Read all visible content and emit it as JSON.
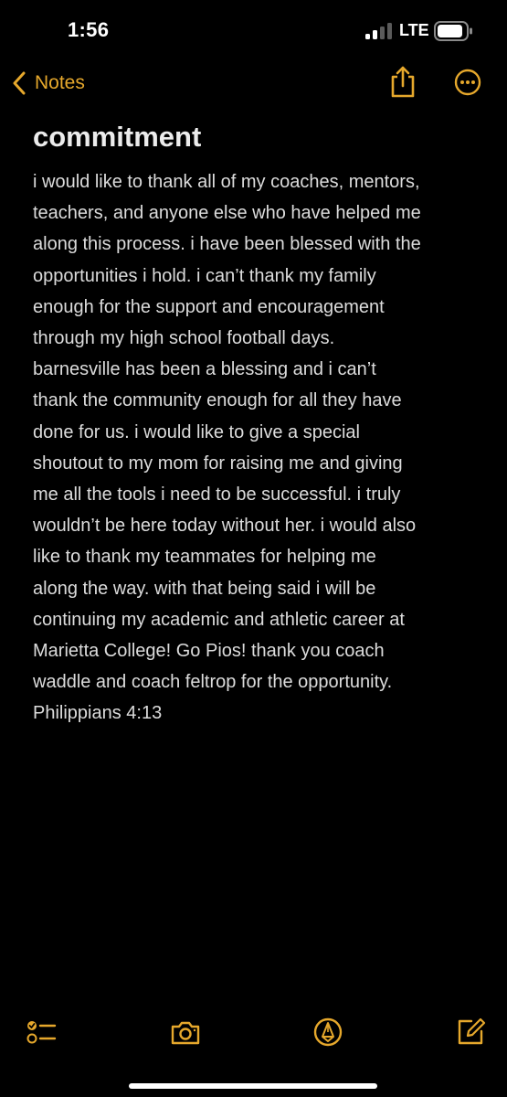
{
  "status_bar": {
    "time": "1:56",
    "carrier": "LTE",
    "icons": [
      "signal-bars-icon",
      "battery-icon"
    ]
  },
  "nav": {
    "back_label": "Notes",
    "icons": [
      "chevron-left-icon",
      "share-icon",
      "more-options-icon"
    ]
  },
  "note": {
    "title": "commitment",
    "lines": [
      "i would like to thank all of my coaches, mentors,",
      "teachers, and anyone else who have helped me",
      "along this process. i have been blessed with the",
      "opportunities i hold. i can’t thank my family",
      "enough for the support and encouragement",
      "through my high school football days.",
      "barnesville has been a blessing and i can’t",
      "thank the community enough for all they have",
      "done for us. i would like to give a special",
      "shoutout to my mom for raising me and giving",
      "me all the tools i need to be successful. i truly",
      "wouldn’t be here today without her. i would also",
      "like to thank my teammates for helping me",
      "along the way. with that being said i will be",
      "continuing my academic and athletic career at",
      "Marietta College! Go Pios! thank you coach",
      "waddle and coach feltrop for the opportunity.",
      "Philippians 4:13"
    ]
  },
  "toolbar": {
    "icons": [
      "checklist-icon",
      "camera-icon",
      "markup-pen-icon",
      "compose-icon"
    ]
  },
  "colors": {
    "accent": "#e6a82c",
    "background": "#000000",
    "text": "#dcdcdc"
  }
}
